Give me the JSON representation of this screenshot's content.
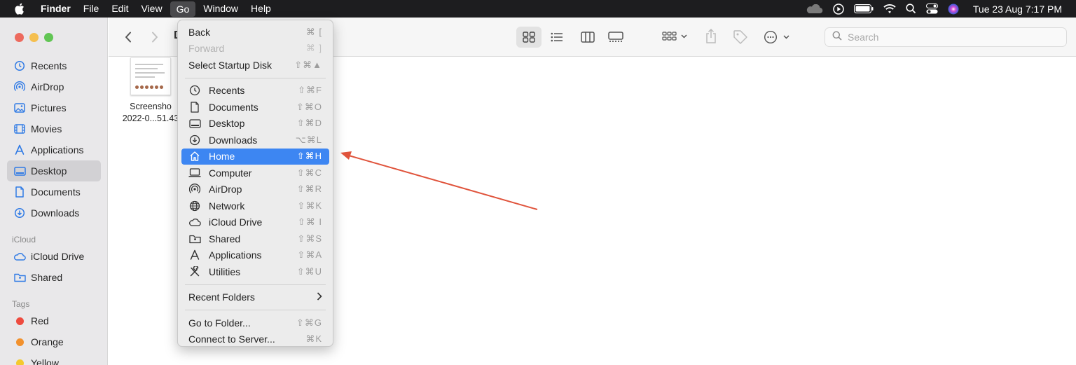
{
  "menubar": {
    "app_name": "Finder",
    "items": [
      "File",
      "Edit",
      "View",
      "Go",
      "Window",
      "Help"
    ],
    "active_item": "Go",
    "clock": "Tue 23 Aug  7:17 PM",
    "status_icons": [
      "cloud-icon",
      "play-circle-icon",
      "battery-icon",
      "wifi-icon",
      "spotlight-search-icon",
      "control-center-icon",
      "siri-icon"
    ]
  },
  "window": {
    "title_fragment": "D"
  },
  "sidebar": {
    "favorites": [
      {
        "label": "Recents",
        "icon": "clock-icon"
      },
      {
        "label": "AirDrop",
        "icon": "airdrop-icon"
      },
      {
        "label": "Pictures",
        "icon": "pictures-icon"
      },
      {
        "label": "Movies",
        "icon": "movies-icon"
      },
      {
        "label": "Applications",
        "icon": "applications-icon"
      },
      {
        "label": "Desktop",
        "icon": "desktop-icon",
        "selected": true
      },
      {
        "label": "Documents",
        "icon": "document-icon"
      },
      {
        "label": "Downloads",
        "icon": "download-icon"
      }
    ],
    "icloud_header": "iCloud",
    "icloud": [
      {
        "label": "iCloud Drive",
        "icon": "icloud-icon"
      },
      {
        "label": "Shared",
        "icon": "shared-folder-icon"
      }
    ],
    "tags_header": "Tags",
    "tags": [
      {
        "label": "Red",
        "color": "#ee4b3f"
      },
      {
        "label": "Orange",
        "color": "#f2912d"
      },
      {
        "label": "Yellow",
        "color": "#f4c92e"
      }
    ]
  },
  "toolbar": {
    "search_placeholder": "Search"
  },
  "content": {
    "file_name_line1": "Screensho",
    "file_name_line2": "2022-0...51.43"
  },
  "go_menu": {
    "group1": [
      {
        "label": "Back",
        "shortcut": "⌘ [",
        "disabled": false
      },
      {
        "label": "Forward",
        "shortcut": "⌘ ]",
        "disabled": true
      },
      {
        "label": "Select Startup Disk",
        "shortcut": "⇧⌘▲",
        "disabled": false
      }
    ],
    "group2": [
      {
        "label": "Recents",
        "shortcut": "⇧⌘F",
        "icon": "clock-icon"
      },
      {
        "label": "Documents",
        "shortcut": "⇧⌘O",
        "icon": "document-icon"
      },
      {
        "label": "Desktop",
        "shortcut": "⇧⌘D",
        "icon": "desktop-icon"
      },
      {
        "label": "Downloads",
        "shortcut": "⌥⌘L",
        "icon": "download-icon"
      },
      {
        "label": "Home",
        "shortcut": "⇧⌘H",
        "icon": "home-icon",
        "highlighted": true
      },
      {
        "label": "Computer",
        "shortcut": "⇧⌘C",
        "icon": "computer-icon"
      },
      {
        "label": "AirDrop",
        "shortcut": "⇧⌘R",
        "icon": "airdrop-icon"
      },
      {
        "label": "Network",
        "shortcut": "⇧⌘K",
        "icon": "network-globe-icon"
      },
      {
        "label": "iCloud Drive",
        "shortcut": "⇧⌘ I",
        "icon": "icloud-icon"
      },
      {
        "label": "Shared",
        "shortcut": "⇧⌘S",
        "icon": "shared-folder-icon"
      },
      {
        "label": "Applications",
        "shortcut": "⇧⌘A",
        "icon": "applications-icon"
      },
      {
        "label": "Utilities",
        "shortcut": "⇧⌘U",
        "icon": "utilities-icon"
      }
    ],
    "recent_folders": "Recent Folders",
    "group4": [
      {
        "label": "Go to Folder...",
        "shortcut": "⇧⌘G"
      },
      {
        "label": "Connect to Server...",
        "shortcut": "⌘K"
      }
    ]
  },
  "annotation": {
    "arrow_color": "#e0533b"
  }
}
